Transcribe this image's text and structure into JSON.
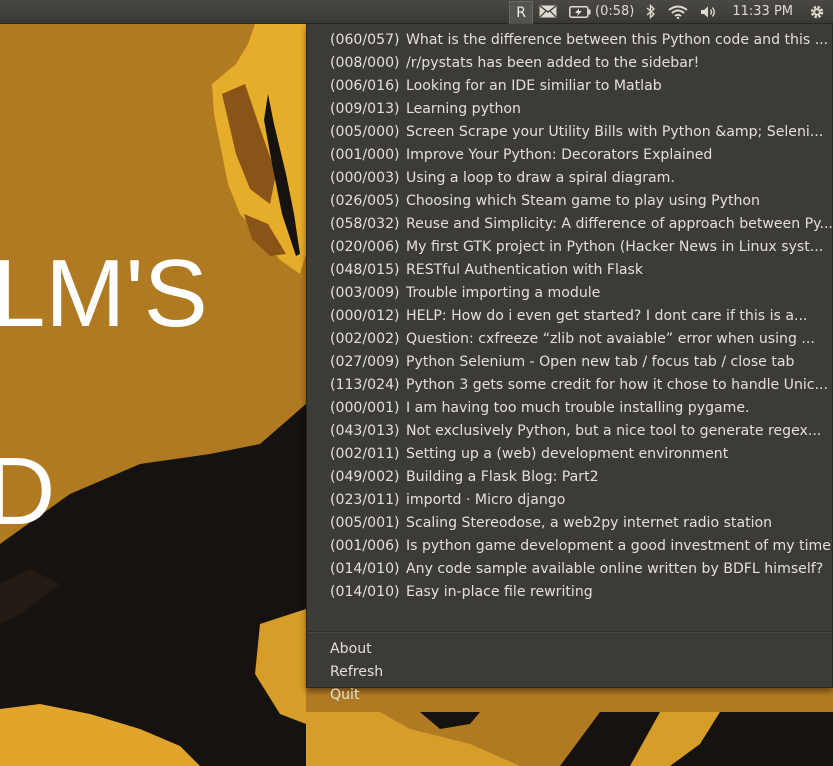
{
  "topbar": {
    "reddit_indicator": "R",
    "battery_text": "(0:58)",
    "clock": "11:33 PM",
    "icons": [
      "mail-icon",
      "battery-icon",
      "bluetooth-icon",
      "wifi-icon",
      "volume-icon",
      "gear-icon"
    ]
  },
  "wallpaper": {
    "text_line1": "LM'S",
    "text_line2": "D",
    "colors": {
      "gold": "#b07a22",
      "bright_gold": "#e9b02a",
      "dark": "#1a1612"
    }
  },
  "menu": {
    "items": [
      {
        "count": "(060/057)",
        "title": "What is the difference between this Python code and this ..."
      },
      {
        "count": "(008/000)",
        "title": "/r/pystats has been added to the sidebar!"
      },
      {
        "count": "(006/016)",
        "title": "Looking for an IDE similiar to Matlab"
      },
      {
        "count": "(009/013)",
        "title": "Learning python"
      },
      {
        "count": "(005/000)",
        "title": "Screen Scrape your Utility Bills with Python &amp; Seleni..."
      },
      {
        "count": "(001/000)",
        "title": "Improve Your Python: Decorators Explained"
      },
      {
        "count": "(000/003)",
        "title": "Using a loop to draw a spiral diagram."
      },
      {
        "count": "(026/005)",
        "title": "Choosing which Steam game to play using Python"
      },
      {
        "count": "(058/032)",
        "title": "Reuse and Simplicity: A difference of approach between Py..."
      },
      {
        "count": "(020/006)",
        "title": "My first GTK project in Python (Hacker News in Linux syst..."
      },
      {
        "count": "(048/015)",
        "title": "RESTful Authentication with Flask"
      },
      {
        "count": "(003/009)",
        "title": "Trouble importing a module"
      },
      {
        "count": "(000/012)",
        "title": "HELP: How do i even get started? I dont care if this is a..."
      },
      {
        "count": "(002/002)",
        "title": "Question: cxfreeze “zlib not avaiable” error when using ..."
      },
      {
        "count": "(027/009)",
        "title": "Python Selenium - Open new tab / focus tab / close tab"
      },
      {
        "count": "(113/024)",
        "title": "Python 3 gets some credit for how it chose to handle Unic..."
      },
      {
        "count": "(000/001)",
        "title": "I am having too much trouble installing pygame."
      },
      {
        "count": "(043/013)",
        "title": "Not exclusively Python, but a nice tool to generate regex..."
      },
      {
        "count": "(002/011)",
        "title": "Setting up a (web) development environment"
      },
      {
        "count": "(049/002)",
        "title": "Building a Flask Blog: Part2"
      },
      {
        "count": "(023/011)",
        "title": "importd · Micro django"
      },
      {
        "count": "(005/001)",
        "title": "Scaling Stereodose, a web2py internet radio station"
      },
      {
        "count": "(001/006)",
        "title": "Is python game development a good investment of my time?"
      },
      {
        "count": "(014/010)",
        "title": "Any code sample available online written by BDFL himself?"
      },
      {
        "count": "(014/010)",
        "title": "Easy in-place file rewriting"
      }
    ],
    "about_label": "About",
    "refresh_label": "Refresh",
    "quit_label": "Quit"
  }
}
